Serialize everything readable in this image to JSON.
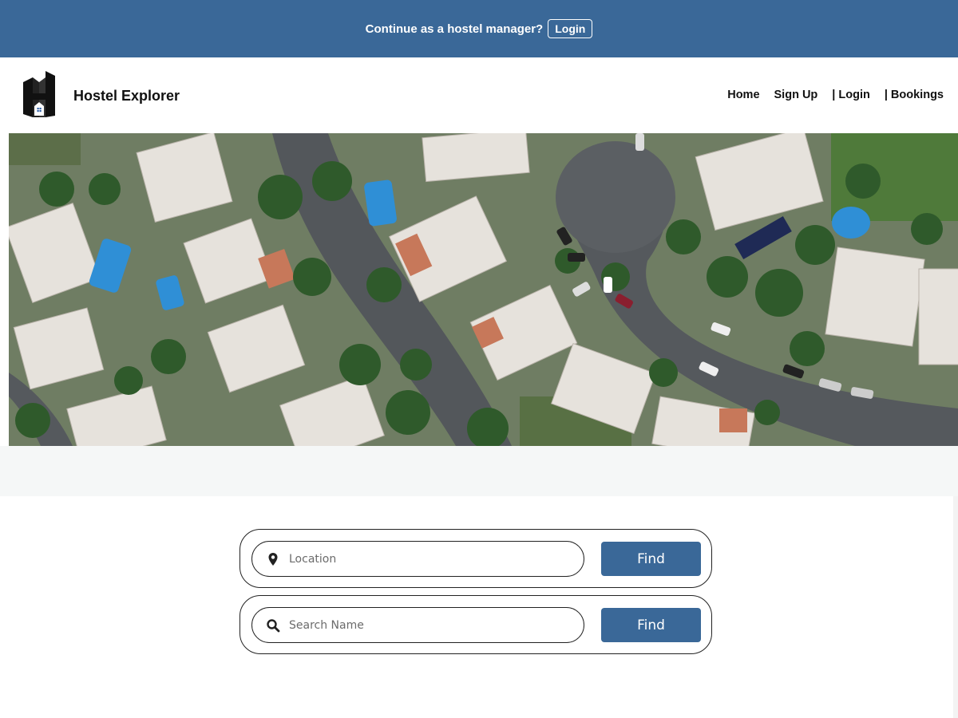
{
  "banner": {
    "text": "Continue as a hostel manager?",
    "login_label": "Login",
    "color": "#3a6898"
  },
  "brand": {
    "name": "Hostel Explorer",
    "logo_icon": "building-logo-icon"
  },
  "nav": {
    "items": [
      "Home",
      "Sign Up",
      "| Login",
      "| Bookings"
    ]
  },
  "hero": {
    "image": "aerial-neighborhood-photo"
  },
  "search": {
    "location": {
      "placeholder": "Location",
      "value": "",
      "icon": "map-pin-icon",
      "button": "Find"
    },
    "name": {
      "placeholder": "Search Name",
      "value": "",
      "icon": "search-icon",
      "button": "Find"
    }
  },
  "colors": {
    "accent": "#3a6898"
  }
}
